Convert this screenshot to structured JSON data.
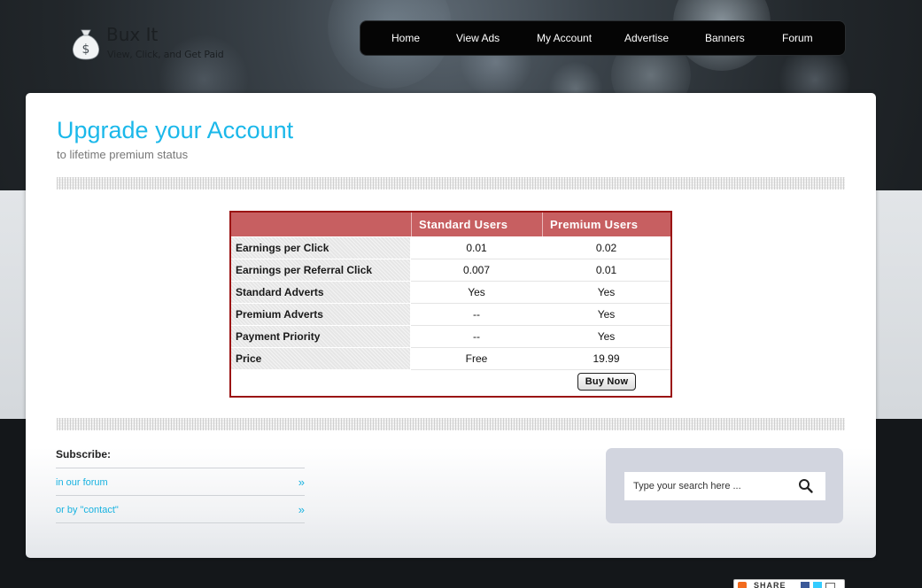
{
  "header": {
    "logo_title": "Bux It",
    "logo_tagline": "View, Click, and Get Paid"
  },
  "nav": {
    "items": [
      {
        "label": "Home"
      },
      {
        "label": "View Ads"
      },
      {
        "label": "My Account"
      },
      {
        "label": "Advertise"
      },
      {
        "label": "Banners"
      },
      {
        "label": "Forum"
      }
    ]
  },
  "main": {
    "title": "Upgrade your Account",
    "subtitle": "to lifetime premium status"
  },
  "comparison": {
    "columns": [
      "Standard Users",
      "Premium Users"
    ],
    "rows": [
      {
        "label": "Earnings per Click",
        "standard": "0.01",
        "premium": "0.02"
      },
      {
        "label": "Earnings per Referral Click",
        "standard": "0.007",
        "premium": "0.01"
      },
      {
        "label": "Standard Adverts",
        "standard": "Yes",
        "premium": "Yes"
      },
      {
        "label": "Premium Adverts",
        "standard": "--",
        "premium": "Yes"
      },
      {
        "label": "Payment Priority",
        "standard": "--",
        "premium": "Yes"
      },
      {
        "label": "Price",
        "standard": "Free",
        "premium": "19.99"
      }
    ],
    "buy_label": "Buy Now"
  },
  "subscribe": {
    "title": "Subscribe:",
    "links": [
      {
        "label": "in our forum",
        "arrow": "»"
      },
      {
        "label": "or by \"contact\"",
        "arrow": "»"
      }
    ]
  },
  "search": {
    "placeholder": "Type your search here ..."
  },
  "share": {
    "label": "SHARE"
  },
  "colors": {
    "accent": "#1bb8ea",
    "table_header": "#c75f61",
    "table_border": "#9b1414",
    "nav_bg": "#050505"
  }
}
